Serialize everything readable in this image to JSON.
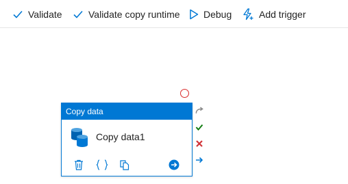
{
  "toolbar": {
    "validate_label": "Validate",
    "validate_copy_runtime_label": "Validate copy runtime",
    "debug_label": "Debug",
    "add_trigger_label": "Add trigger"
  },
  "activity": {
    "type_label": "Copy data",
    "name": "Copy data1"
  },
  "icons": {
    "validate": "checkmark-icon",
    "validate_copy_runtime": "checkmark-icon",
    "debug": "play-icon",
    "add_trigger": "lightning-plus-icon",
    "activity_type": "database-icon",
    "delete": "trash-icon",
    "code": "braces-icon",
    "clone": "copy-icon",
    "go": "arrow-right-circle-icon",
    "skip": "redo-arrow-icon",
    "success": "check-icon",
    "failure": "x-icon",
    "completion": "arrow-right-icon"
  },
  "colors": {
    "accent": "#0078d4",
    "success": "#107c10",
    "failure": "#d13438",
    "error_circle": "#d92b2b",
    "skip": "#8a8a8a"
  }
}
